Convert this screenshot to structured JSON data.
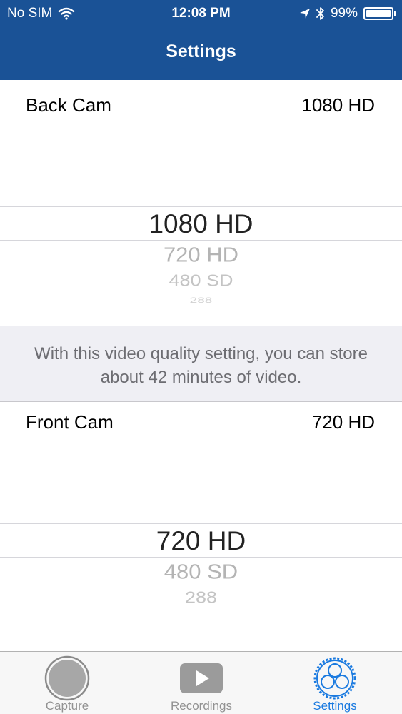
{
  "status": {
    "carrier": "No SIM",
    "time": "12:08 PM",
    "battery": "99%",
    "battery_level": 0.99
  },
  "nav": {
    "title": "Settings"
  },
  "back_cam": {
    "label": "Back Cam",
    "value": "1080 HD",
    "options": [
      "1080 HD",
      "720 HD",
      "480 SD",
      "288"
    ]
  },
  "note": {
    "text": "With this video quality setting, you can store about 42 minutes of video."
  },
  "front_cam": {
    "label": "Front Cam",
    "value": "720 HD",
    "options": [
      "720 HD",
      "480 SD",
      "288"
    ]
  },
  "tabs": [
    {
      "label": "Capture"
    },
    {
      "label": "Recordings"
    },
    {
      "label": "Settings"
    }
  ],
  "colors": {
    "nav_bar": "#1a5296",
    "tab_active": "#1a7ae0",
    "tab_inactive": "#929292",
    "note_background": "#efeff4"
  }
}
